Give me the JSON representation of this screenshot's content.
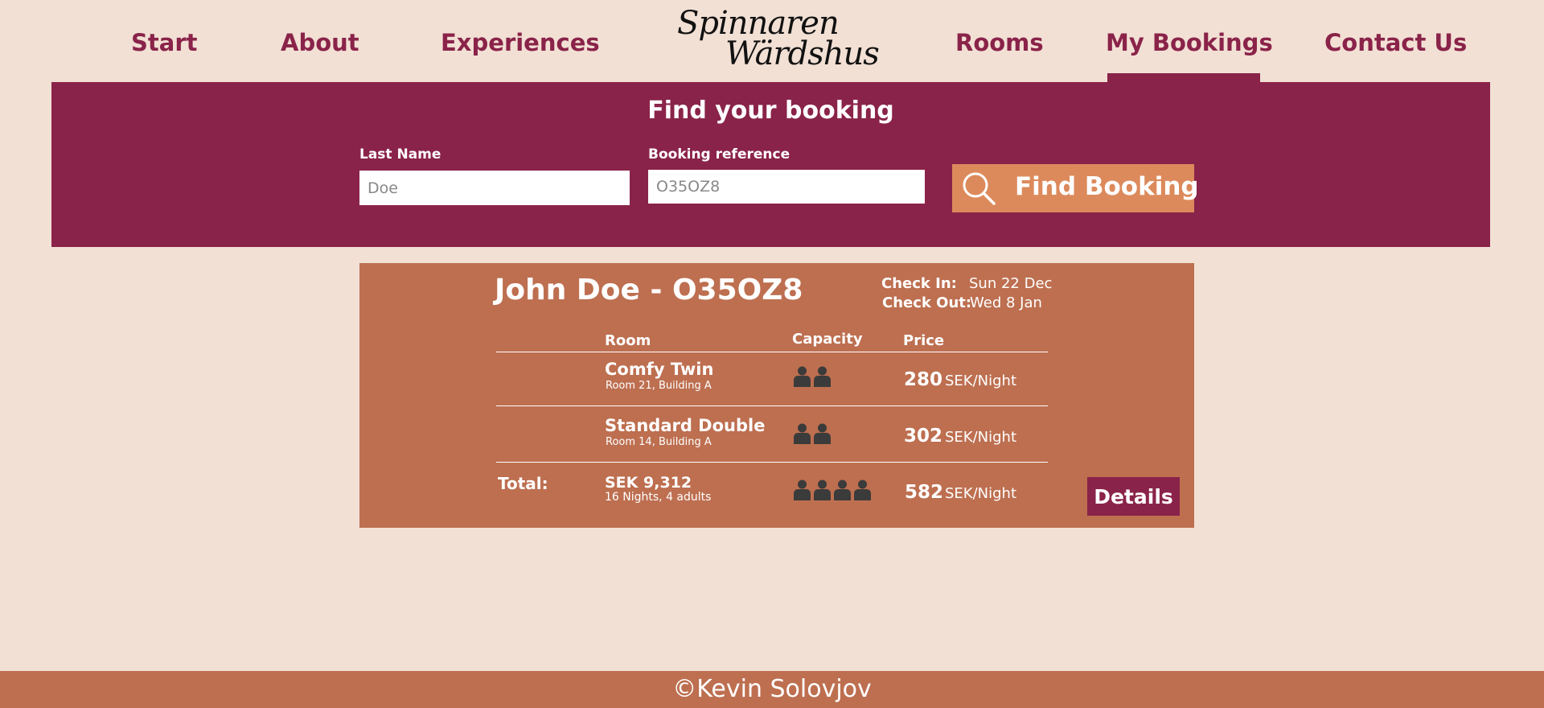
{
  "nav": {
    "items": [
      {
        "label": "Start"
      },
      {
        "label": "About"
      },
      {
        "label": "Experiences"
      },
      {
        "label": "Rooms"
      },
      {
        "label": "My Bookings",
        "active": true
      },
      {
        "label": "Contact Us"
      }
    ],
    "logo": {
      "line1": "Spinnaren",
      "line2": "Wärdshus"
    }
  },
  "search": {
    "title": "Find your booking",
    "last_name_label": "Last Name",
    "last_name_placeholder": "Doe",
    "reference_label": "Booking reference",
    "reference_placeholder": "O35OZ8",
    "button_label": "Find Booking",
    "button_icon": "search-icon"
  },
  "booking": {
    "title": "John Doe - O35OZ8",
    "check_in_label": "Check In:",
    "check_in_value": "Sun 22 Dec",
    "check_out_label": "Check Out:",
    "check_out_value": "Wed 8 Jan",
    "columns": {
      "room": "Room",
      "capacity": "Capacity",
      "price": "Price"
    },
    "rooms": [
      {
        "name": "Comfy Twin",
        "location": "Room 21, Building A",
        "capacity": 2,
        "price": "280",
        "unit": "SEK/Night"
      },
      {
        "name": "Standard Double",
        "location": "Room 14, Building A",
        "capacity": 2,
        "price": "302",
        "unit": "SEK/Night"
      }
    ],
    "total": {
      "label": "Total:",
      "amount": "SEK 9,312",
      "summary": "16 Nights, 4 adults",
      "capacity": 4,
      "price": "582",
      "unit": "SEK/Night"
    },
    "details_label": "Details"
  },
  "footer": {
    "text": "©Kevin Solovjov"
  },
  "colors": {
    "background": "#f2e0d5",
    "brand": "#8a2349",
    "card": "#bd6f50",
    "button": "#dc8a5c",
    "icon": "#3b3b3b"
  }
}
